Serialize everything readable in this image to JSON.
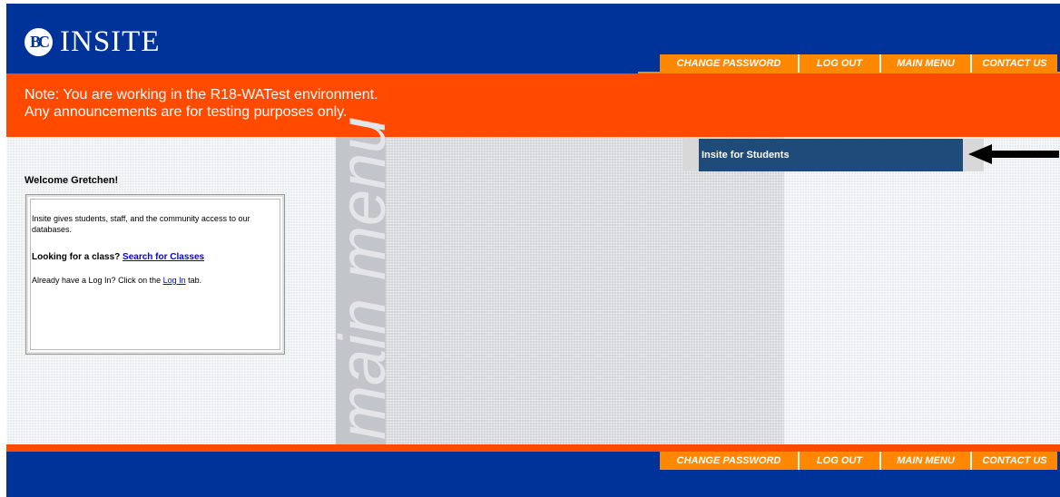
{
  "header": {
    "logo_mark": "BC",
    "logo_text": "INSITE",
    "nav": [
      "CHANGE PASSWORD",
      "LOG OUT",
      "MAIN MENU",
      "CONTACT US"
    ]
  },
  "notice": {
    "line1": "Note: You are working in the R18-WATest environment.",
    "line2": "Any announcements are for testing purposes only."
  },
  "content": {
    "watermark": "main menu",
    "welcome": "Welcome Gretchen!",
    "info": {
      "description": "Insite gives students, staff, and the community access to our databases.",
      "looking_prefix": "Looking for a class?",
      "search_link": "Search for Classes",
      "login_prefix": "Already have a Log In? Click on the",
      "login_link": "Log In",
      "login_suffix": "tab."
    },
    "menu_items": [
      "Insite for Students"
    ]
  },
  "footer": {
    "nav": [
      "CHANGE PASSWORD",
      "LOG OUT",
      "MAIN MENU",
      "CONTACT US"
    ]
  },
  "colors": {
    "header_blue": "#003399",
    "notice_orange": "#ff4a00",
    "nav_orange": "#ff8800",
    "menu_item_blue": "#1e4b7a"
  }
}
